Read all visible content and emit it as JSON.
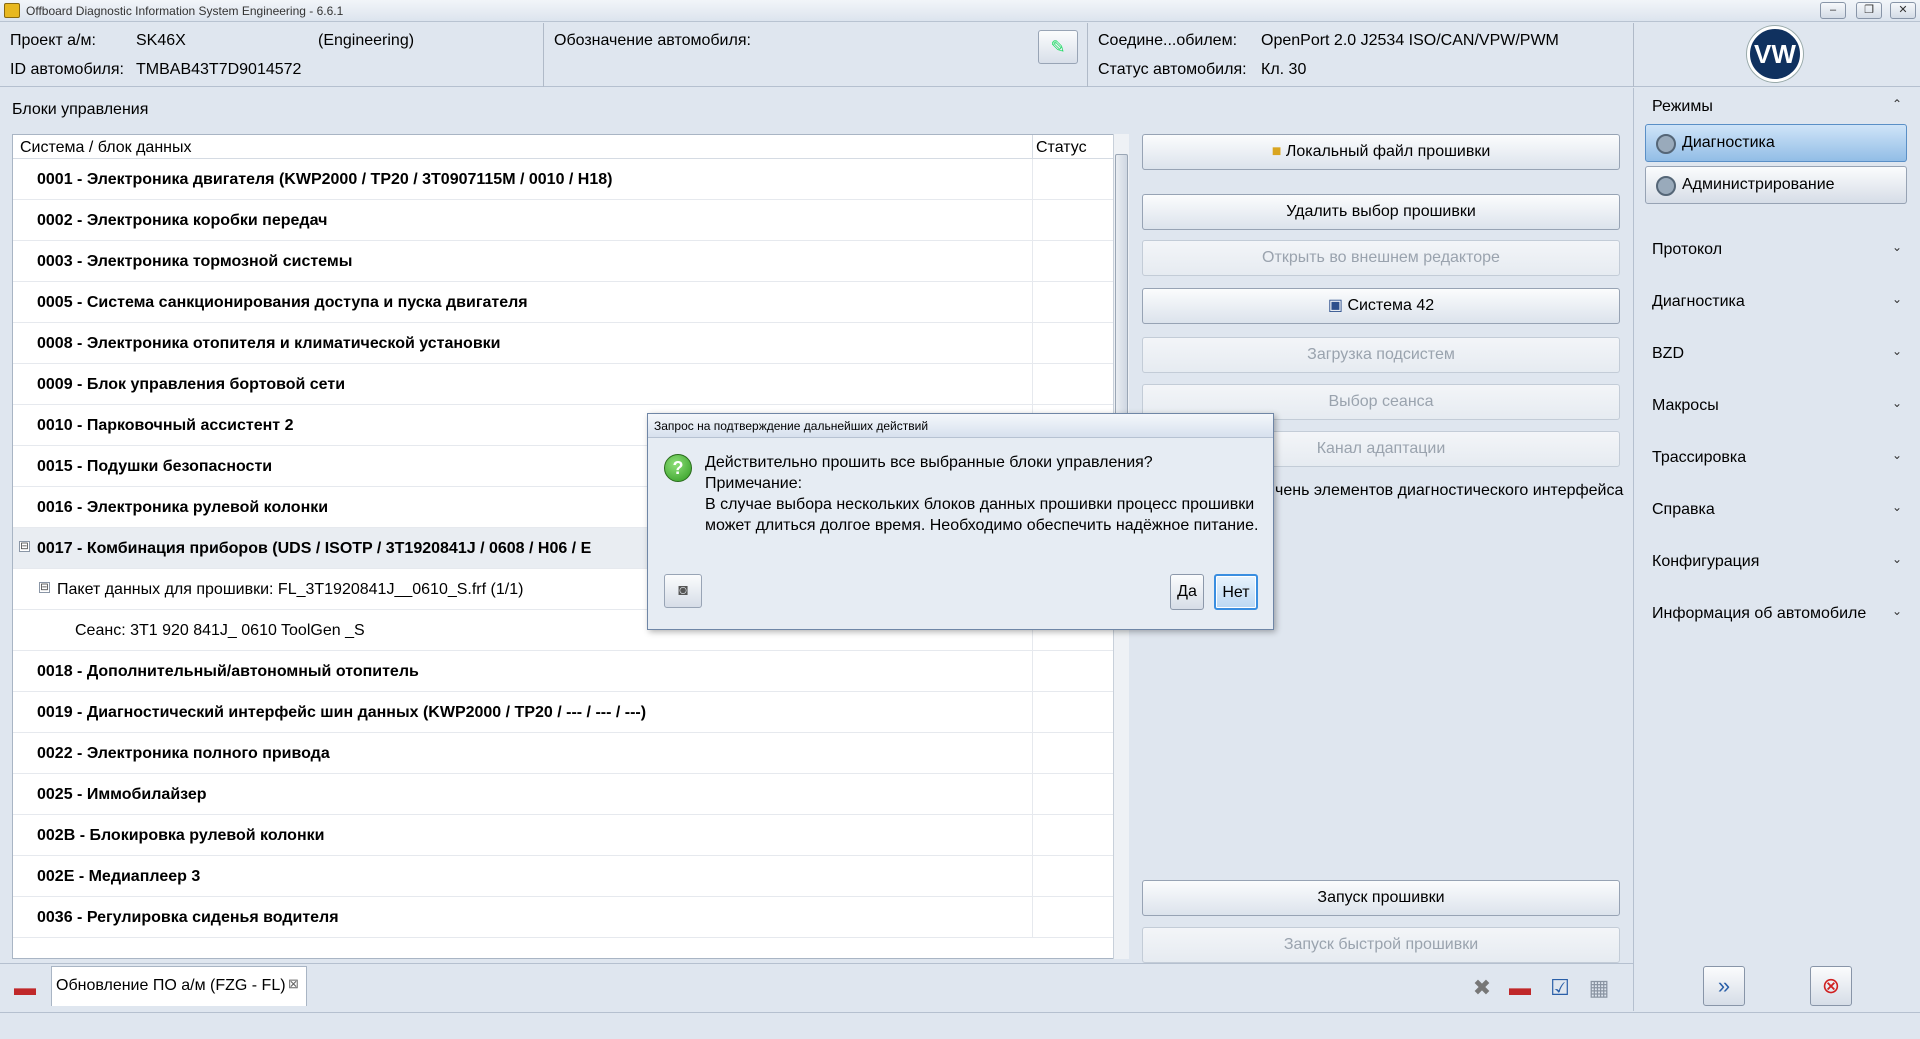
{
  "window": {
    "title": "Offboard Diagnostic Information System Engineering - 6.6.1"
  },
  "header": {
    "project_label": "Проект а/м:",
    "project_value": "SK46X",
    "project_mode": "(Engineering)",
    "vin_label": "ID автомобиля:",
    "vin_value": "TMBAB43T7D9014572",
    "designation_label": "Обозначение автомобиля:",
    "connection_label": "Соедине...обилем:",
    "connection_value": "OpenPort 2.0 J2534 ISO/CAN/VPW/PWM",
    "status_label": "Статус автомобиля:",
    "status_value": "Кл. 30",
    "logo_text": "VW"
  },
  "left": {
    "title": "Блоки управления",
    "col_system": "Система / блок данных",
    "col_status": "Статус",
    "rows": [
      {
        "text": "0001 - Электроника двигателя  (KWP2000 / TP20 / 3T0907115M / 0010 / H18)"
      },
      {
        "text": "0002 - Электроника коробки передач"
      },
      {
        "text": "0003 - Электроника тормозной системы"
      },
      {
        "text": "0005 - Система санкционирования доступа и пуска двигателя"
      },
      {
        "text": "0008 - Электроника отопителя и климатической установки"
      },
      {
        "text": "0009 - Блок управления бортовой сети"
      },
      {
        "text": "0010 - Парковочный ассистент 2"
      },
      {
        "text": "0015 - Подушки безопасности"
      },
      {
        "text": "0016 - Электроника рулевой колонки"
      },
      {
        "text": "0017 - Комбинация приборов  (UDS / ISOTP / 3T1920841J / 0608 / H06 / E"
      },
      {
        "text": "Пакет данных для прошивки: FL_3T1920841J__0610_S.frf (1/1)"
      },
      {
        "text": "Сеанс: 3T1 920 841J_ 0610 ToolGen _S"
      },
      {
        "text": "0018 - Дополнительный/автономный отопитель"
      },
      {
        "text": "0019 - Диагностический интерфейс шин данных  (KWP2000 / TP20 / --- / --- / ---)"
      },
      {
        "text": "0022 - Электроника полного привода"
      },
      {
        "text": "0025 - Иммобилайзер"
      },
      {
        "text": "002B - Блокировка рулевой колонки"
      },
      {
        "text": "002E - Медиаплеер 3"
      },
      {
        "text": "0036 - Регулировка сиденья водителя"
      }
    ],
    "toggle_minus": "⊟"
  },
  "middle": {
    "btn_local_file": "Локальный файл прошивки",
    "btn_delete_selection": "Удалить выбор прошивки",
    "btn_open_external": "Открыть во внешнем редакторе",
    "btn_system42": "Система 42",
    "btn_load_subsystems": "Загрузка подсистем",
    "btn_session_select": "Выбор сеанса",
    "btn_adapt_channel": "Канал адаптации",
    "partial_text": "чень элементов диагностического интерфейса",
    "btn_start_flash": "Запуск прошивки",
    "btn_start_quick_flash": "Запуск быстрой прошивки"
  },
  "right": {
    "modes_label": "Режимы",
    "btn_diagnostics": "Диагностика",
    "btn_admin": "Администрирование",
    "sections": [
      "Протокол",
      "Диагностика",
      "BZD",
      "Макросы",
      "Трассировка",
      "Справка",
      "Конфигурация",
      "Информация об автомобиле"
    ],
    "chev_up": "⌃",
    "chev_down": "⌄"
  },
  "bottom": {
    "tab_label": "Обновление ПО а/м (FZG - FL)",
    "tab_close": "⊠"
  },
  "dialog": {
    "title": "Запрос на подтверждение дальнейших действий",
    "line1": "Действительно прошить все выбранные блоки управления?",
    "line2": "Примечание:",
    "line3": "В случае выбора нескольких блоков данных прошивки процесс прошивки",
    "line4": "может длиться долгое время. Необходимо обеспечить надёжное питание.",
    "btn_yes": "Да",
    "btn_no": "Нет"
  },
  "colors": {
    "accent": "#3a8ee0",
    "panel_bg": "#dfe6ef",
    "dialog_bg": "#e6ecf3"
  }
}
